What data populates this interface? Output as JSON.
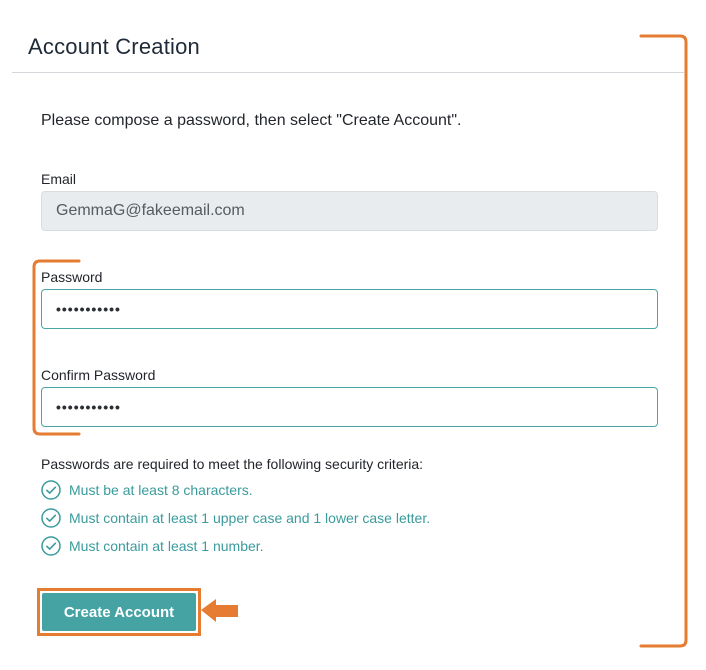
{
  "page": {
    "title": "Account Creation"
  },
  "form": {
    "intro": "Please compose a password, then select \"Create Account\".",
    "email": {
      "label": "Email",
      "value": "GemmaG@fakeemail.com"
    },
    "password": {
      "label": "Password",
      "value": "•••••••••••"
    },
    "confirm_password": {
      "label": "Confirm Password",
      "value": "•••••••••••"
    },
    "criteria": {
      "heading": "Passwords are required to meet the following security criteria:",
      "items": [
        "Must be at least 8 characters.",
        "Must contain at least 1 upper case and 1 lower case letter.",
        "Must contain at least 1 number."
      ]
    },
    "submit_label": "Create Account"
  },
  "colors": {
    "accent_teal": "#45a3a4",
    "annotation_orange": "#e57c31",
    "readonly_bg": "#e9ecee"
  },
  "icons": {
    "criteria": "check-circle-icon",
    "pointer": "left-arrow-icon"
  }
}
